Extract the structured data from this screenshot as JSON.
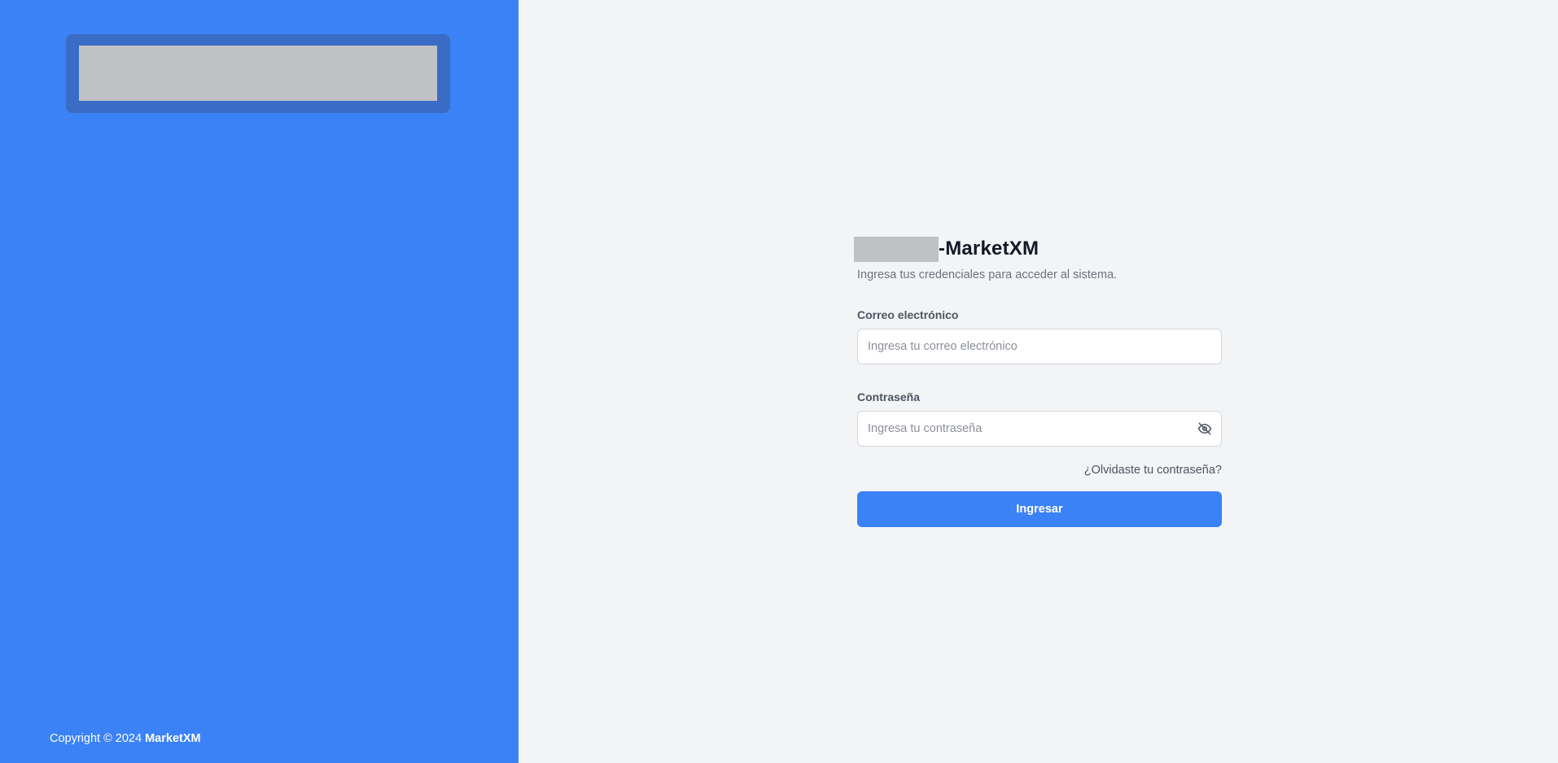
{
  "sidebar": {
    "copyright_prefix": "Copyright © 2024 ",
    "copyright_brand": "MarketXM",
    "background_color": "#3b82f6"
  },
  "login": {
    "title_suffix": "-MarketXM",
    "subtitle": "Ingresa tus credenciales para acceder al sistema.",
    "email": {
      "label": "Correo electrónico",
      "placeholder": "Ingresa tu correo electrónico",
      "value": ""
    },
    "password": {
      "label": "Contraseña",
      "placeholder": "Ingresa tu contraseña",
      "value": "",
      "toggle_icon": "eye-off-icon"
    },
    "forgot_password": "¿Olvidaste tu contraseña?",
    "submit_label": "Ingresar",
    "accent_color": "#3b82f6"
  }
}
